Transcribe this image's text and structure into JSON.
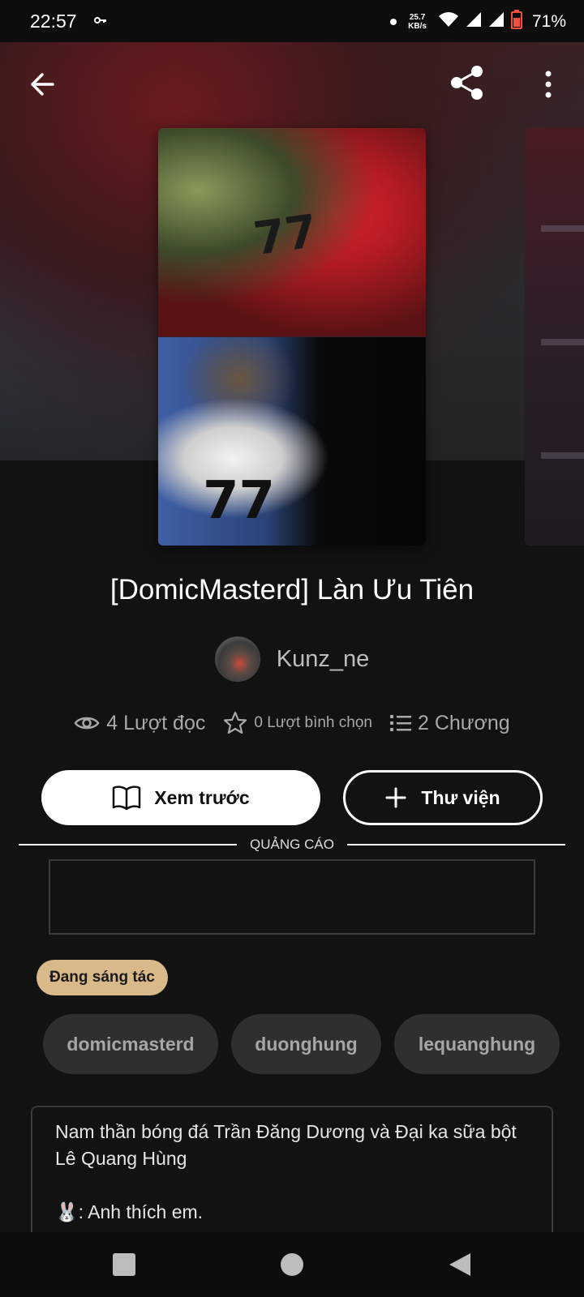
{
  "status_bar": {
    "time": "22:57",
    "key_icon": "key-icon",
    "speed_value": "25.7",
    "speed_unit": "KB/s",
    "battery": "71%"
  },
  "toolbar": {
    "back_icon": "arrow-left-icon",
    "share_icon": "share-icon",
    "more_icon": "more-vertical-icon"
  },
  "cover": {
    "jersey_top": "77",
    "jersey_bottom": "77"
  },
  "story": {
    "title": "[DomicMasterd] Làn Ưu Tiên",
    "author": "Kunz_ne",
    "reads": "4 Lượt đọc",
    "votes": "0 Lượt bình chọn",
    "chapters": "2 Chương"
  },
  "actions": {
    "preview_label": "Xem trước",
    "library_label": "Thư viện"
  },
  "ad": {
    "label": "QUẢNG CÁO"
  },
  "status_badge": "Đang sáng tác",
  "tags": [
    "domicmasterd",
    "duonghung",
    "lequanghung"
  ],
  "description": {
    "line1": "Nam thần bóng đá Trần Đăng Dương và Đại ka sữa bột",
    "line2": "Lê Quang Hùng",
    "line3": "🐰: Anh thích em."
  },
  "colors": {
    "background": "#121212",
    "badge": "#d9b98a",
    "tag_bg": "#2f2f2f"
  }
}
